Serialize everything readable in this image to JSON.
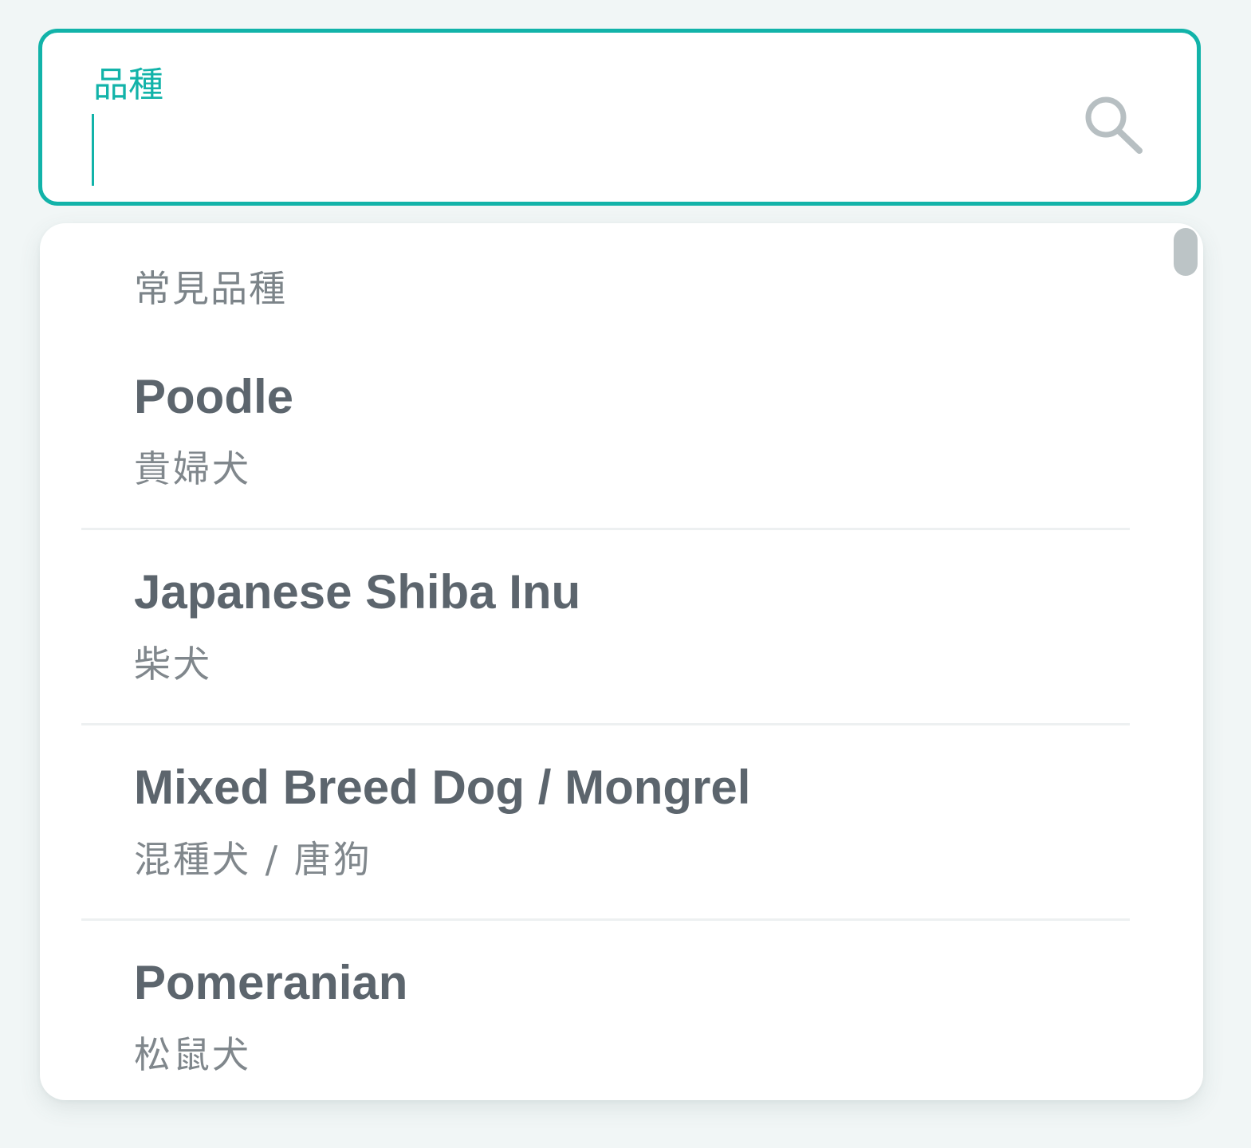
{
  "search": {
    "label": "品種",
    "value": "",
    "icon": "search-icon"
  },
  "dropdown": {
    "section_heading": "常見品種",
    "items": [
      {
        "name_en": "Poodle",
        "name_zh": "貴婦犬"
      },
      {
        "name_en": "Japanese Shiba Inu",
        "name_zh": "柴犬"
      },
      {
        "name_en": "Mixed Breed Dog / Mongrel",
        "name_zh": "混種犬 / 唐狗"
      },
      {
        "name_en": "Pomeranian",
        "name_zh": "松鼠犬"
      }
    ]
  },
  "colors": {
    "accent": "#12b3a9",
    "text_primary": "#5c656d",
    "text_secondary": "#80878c",
    "background": "#f1f6f6"
  }
}
